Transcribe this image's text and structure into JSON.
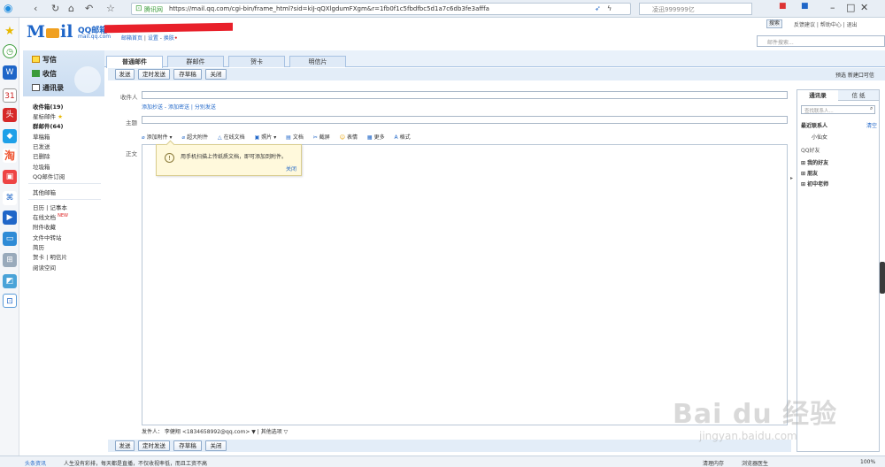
{
  "browser": {
    "site_label": "腾讯网",
    "url": "https://mail.qq.com/cgi-bin/frame_html?sid=kiJ-qQXlgdumFXgm&r=1fb0f1c5fbdfbc5d1a7c6db3fe3afffa",
    "search_text": "凌迅999999亿"
  },
  "header": {
    "brand": "QQ邮箱",
    "brand_domain": "mail.qq.com",
    "links": [
      "邮箱首页",
      "设置",
      "换肤"
    ],
    "top_links": "反馈建议 | 帮助中心 | 退出",
    "search_btn": "搜索",
    "search_placeholder": "邮件搜索..."
  },
  "sidebar": {
    "compose": "写信",
    "inbox": "收信",
    "contacts": "通讯录",
    "folders": [
      "收件箱(19)",
      "星标邮件",
      "群邮件(64)",
      "草稿箱",
      "已发送",
      "已删除",
      "垃圾箱",
      "QQ邮件订阅"
    ],
    "other": "其他邮箱",
    "tools": [
      "日历 | 记事本",
      "在线文档",
      "附件收藏",
      "文件中转站",
      "简历",
      "贺卡 | 明信片",
      "阅读空间"
    ],
    "new_badge": "NEW"
  },
  "tabs": [
    "普通邮件",
    "群邮件",
    "贺卡",
    "明信片"
  ],
  "actions": {
    "send": "发送",
    "timed_send": "定时发送",
    "save_draft": "存草稿",
    "close": "关闭",
    "right_links": "预选  新建口可信"
  },
  "compose": {
    "to_label": "收件人",
    "cc_links": "添加抄送 - 添加密送 | 分别发送",
    "subject_label": "主题",
    "body_label": "正文",
    "toolbar": [
      "添加附件",
      "超大附件",
      "在线文档",
      "照片",
      "文档",
      "截屏",
      "表情",
      "更多",
      "格式"
    ],
    "tip_text": "用手机扫描上传纸质文档，即可添加到附件。",
    "tip_close": "关闭",
    "sender": "发件人： 李健翔 <1834658992@qq.com> ▼  |  其他选项 ▽"
  },
  "contacts_panel": {
    "tabs": [
      "通讯录",
      "信 纸"
    ],
    "search_placeholder": "查找联系人...",
    "recent": "最近联系人",
    "clear": "清空",
    "recent_item": "小仙女",
    "qq_friends": "QQ好友",
    "groups": [
      "我的好友",
      "朋友",
      "初中老师"
    ]
  },
  "status": {
    "news": "头条资讯",
    "ticker": "人生没有彩排，每天都是直播，不仅收视率低，而且工资不高",
    "clean": "清理内存",
    "doctor": "浏览器医生",
    "zoom": "100%"
  },
  "watermark": {
    "main": "Bai du 经验",
    "sub": "jingyan.baidu.com"
  },
  "colors": {
    "accent": "#1f66c8",
    "tab_bg": "#e9f1fa",
    "tip_bg": "#fff9dc"
  }
}
